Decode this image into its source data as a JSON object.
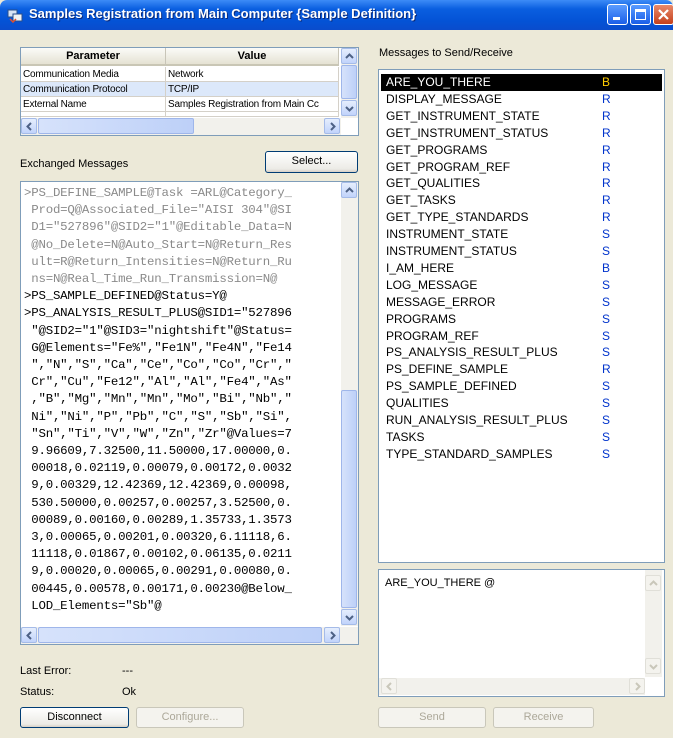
{
  "window": {
    "title": "Samples Registration from Main Computer {Sample Definition}"
  },
  "params": {
    "headers": [
      "Parameter",
      "Value"
    ],
    "rows": [
      {
        "param": "Communication Media",
        "value": "Network"
      },
      {
        "param": "Communication Protocol",
        "value": "TCP/IP"
      },
      {
        "param": "External Name",
        "value": "Samples Registration from Main Cc"
      }
    ]
  },
  "exchanged": {
    "label": "Exchanged Messages",
    "select_label": "Select...",
    "lines": [
      ">PS_DEFINE_SAMPLE@Task =ARL@Category_",
      " Prod=Q@Associated_File=\"AISI 304\"@SI",
      " D1=\"527896\"@SID2=\"1\"@Editable_Data=N",
      " @No_Delete=N@Auto_Start=N@Return_Res",
      " ult=R@Return_Intensities=N@Return_Ru",
      " ns=N@Real_Time_Run_Transmission=N@",
      ">PS_SAMPLE_DEFINED@Status=Y@",
      ">PS_ANALYSIS_RESULT_PLUS@SID1=\"527896",
      " \"@SID2=\"1\"@SID3=\"nightshift\"@Status=",
      " G@Elements=\"Fe%\",\"Fe1N\",\"Fe4N\",\"Fe14",
      " \",\"N\",\"S\",\"Ca\",\"Ce\",\"Co\",\"Co\",\"Cr\",\"",
      " Cr\",\"Cu\",\"Fe12\",\"Al\",\"Al\",\"Fe4\",\"As\"",
      " ,\"B\",\"Mg\",\"Mn\",\"Mn\",\"Mo\",\"Bi\",\"Nb\",\"",
      " Ni\",\"Ni\",\"P\",\"Pb\",\"C\",\"S\",\"Sb\",\"Si\",",
      " \"Sn\",\"Ti\",\"V\",\"W\",\"Zn\",\"Zr\"@Values=7",
      " 9.96609,7.32500,11.50000,17.00000,0.",
      " 00018,0.02119,0.00079,0.00172,0.0032",
      " 9,0.00329,12.42369,12.42369,0.00098,",
      " 530.50000,0.00257,0.00257,3.52500,0.",
      " 00089,0.00160,0.00289,1.35733,1.3573",
      " 3,0.00065,0.00201,0.00320,6.11118,6.",
      " 11118,0.01867,0.00102,0.06135,0.0211",
      " 9,0.00020,0.00065,0.00291,0.00080,0.",
      " 00445,0.00578,0.00171,0.00230@Below_",
      " LOD_Elements=\"Sb\"@"
    ]
  },
  "status": {
    "last_error_label": "Last Error:",
    "last_error_value": "---",
    "status_label": "Status:",
    "status_value": "Ok"
  },
  "buttons": {
    "disconnect": "Disconnect",
    "configure": "Configure...",
    "send": "Send",
    "receive": "Receive"
  },
  "messages": {
    "label": "Messages to Send/Receive",
    "items": [
      {
        "name": "ARE_YOU_THERE",
        "type": "B",
        "selected": true
      },
      {
        "name": "DISPLAY_MESSAGE",
        "type": "R"
      },
      {
        "name": "GET_INSTRUMENT_STATE",
        "type": "R"
      },
      {
        "name": "GET_INSTRUMENT_STATUS",
        "type": "R"
      },
      {
        "name": "GET_PROGRAMS",
        "type": "R"
      },
      {
        "name": "GET_PROGRAM_REF",
        "type": "R"
      },
      {
        "name": "GET_QUALITIES",
        "type": "R"
      },
      {
        "name": "GET_TASKS",
        "type": "R"
      },
      {
        "name": "GET_TYPE_STANDARDS",
        "type": "R"
      },
      {
        "name": "INSTRUMENT_STATE",
        "type": "S"
      },
      {
        "name": "INSTRUMENT_STATUS",
        "type": "S"
      },
      {
        "name": "I_AM_HERE",
        "type": "B"
      },
      {
        "name": "LOG_MESSAGE",
        "type": "S"
      },
      {
        "name": "MESSAGE_ERROR",
        "type": "S"
      },
      {
        "name": "PROGRAMS",
        "type": "S"
      },
      {
        "name": "PROGRAM_REF",
        "type": "S"
      },
      {
        "name": "PS_ANALYSIS_RESULT_PLUS",
        "type": "S"
      },
      {
        "name": "PS_DEFINE_SAMPLE",
        "type": "R"
      },
      {
        "name": "PS_SAMPLE_DEFINED",
        "type": "S"
      },
      {
        "name": "QUALITIES",
        "type": "S"
      },
      {
        "name": "RUN_ANALYSIS_RESULT_PLUS",
        "type": "S"
      },
      {
        "name": "TASKS",
        "type": "S"
      },
      {
        "name": "TYPE_STANDARD_SAMPLES",
        "type": "S"
      }
    ],
    "memo_text": "ARE_YOU_THERE @"
  },
  "colors": {
    "titlebar": "#0453d6",
    "selection": "#000000",
    "type_letter": "#0033cc"
  }
}
